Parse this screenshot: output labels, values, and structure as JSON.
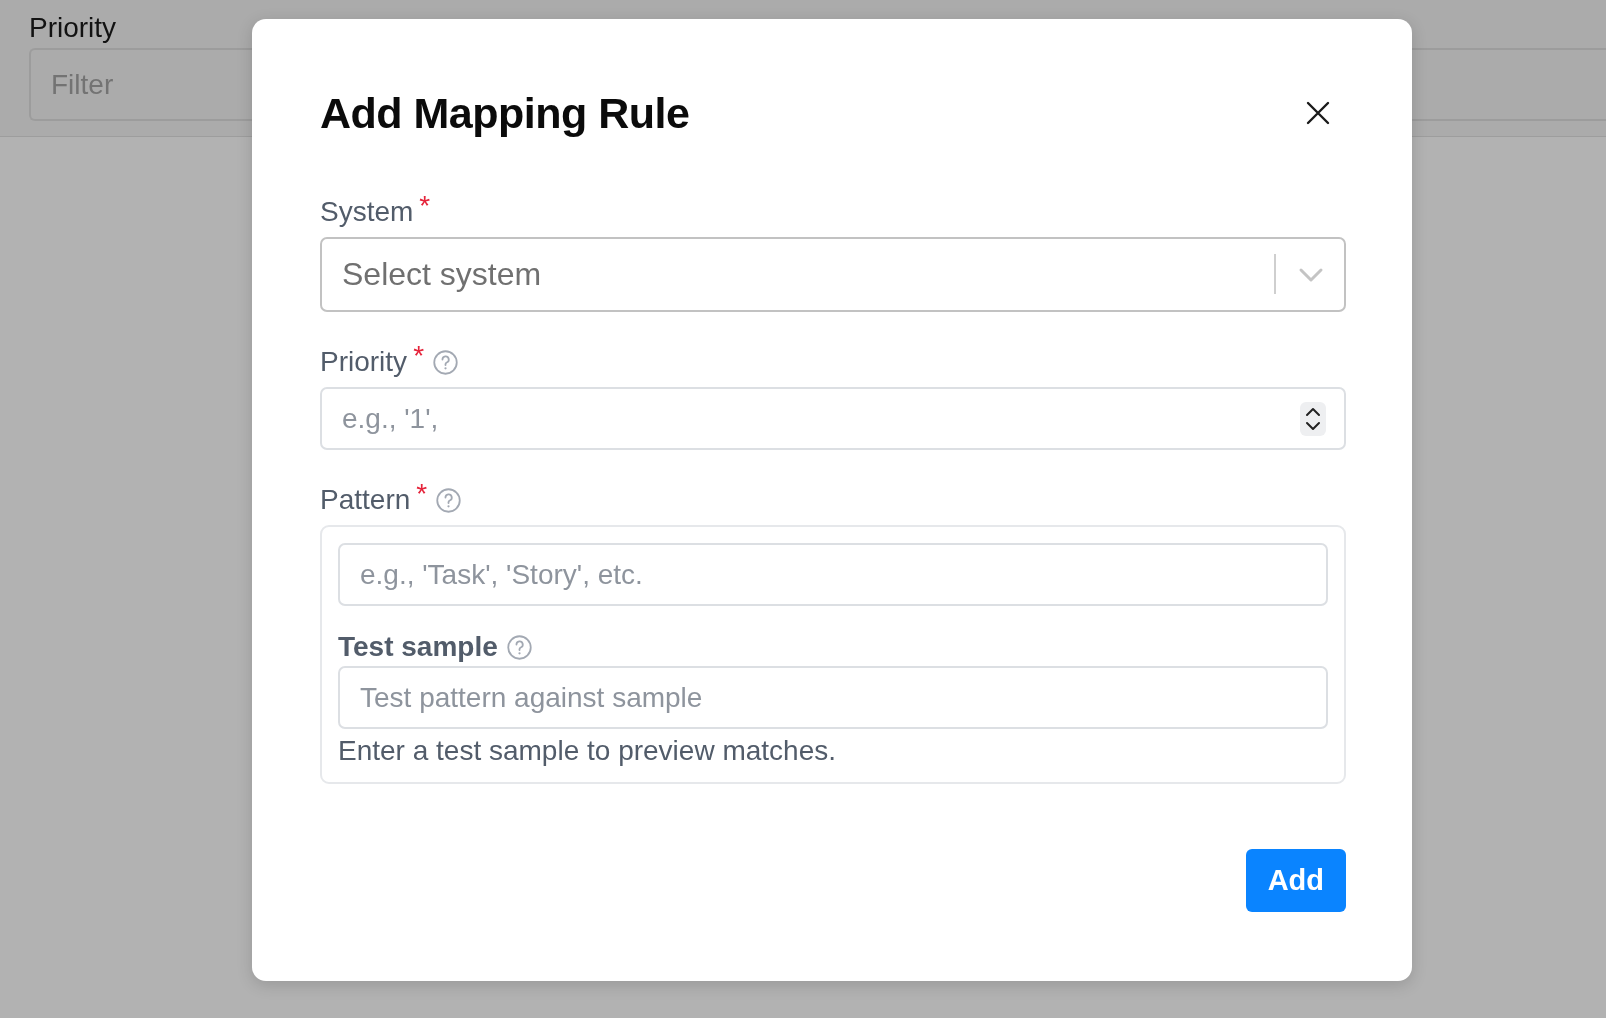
{
  "background": {
    "column_label": "Priority",
    "filter": {
      "placeholder": "Filter"
    }
  },
  "dialog": {
    "title": "Add Mapping Rule",
    "fields": [
      {
        "kind": "select",
        "label": "System",
        "required_mark": "*",
        "help": false,
        "placeholder": "Select system"
      },
      {
        "kind": "number",
        "label": "Priority",
        "required_mark": "*",
        "help": true,
        "placeholder": "e.g., '1',"
      },
      {
        "kind": "pattern",
        "label": "Pattern",
        "required_mark": "*",
        "help": true,
        "placeholder": "e.g., 'Task', 'Story', etc.",
        "test_sample": {
          "label": "Test sample",
          "help": true,
          "placeholder": "Test pattern against sample",
          "hint": "Enter a test sample to preview matches."
        }
      }
    ],
    "add_button": "Add"
  }
}
